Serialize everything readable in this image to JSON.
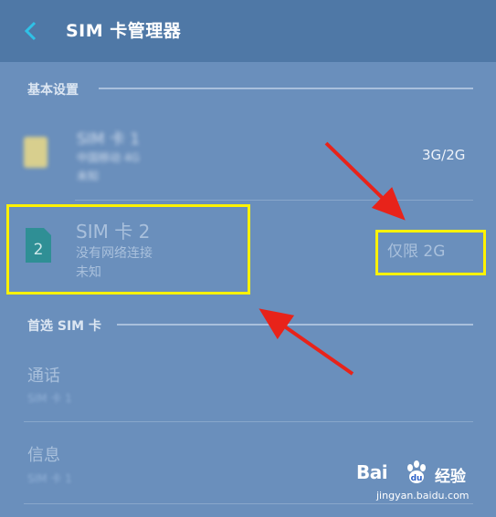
{
  "header": {
    "title": "SIM 卡管理器",
    "back_icon": "chevron-left-icon",
    "accent": "#2fc1e6"
  },
  "sections": {
    "basic": "基本设置",
    "preferred": "首选 SIM 卡"
  },
  "sim1": {
    "name": "SIM 卡 1",
    "carrier": "中国移动 4G",
    "status": "未知",
    "network_type": "3G/2G",
    "icon": "sim-card-icon"
  },
  "sim2": {
    "name": "SIM 卡 2",
    "number": "2",
    "network_status": "没有网络连接",
    "status": "未知",
    "network_type": "仅限 2G",
    "icon": "sim-card-icon"
  },
  "preferred": {
    "call": {
      "label": "通话",
      "value": "SIM 卡 1"
    },
    "message": {
      "label": "信息",
      "value": "SIM 卡 1"
    }
  },
  "watermark": {
    "brand": "Bai",
    "brand2": "经验",
    "url": "jingyan.baidu.com"
  },
  "colors": {
    "highlight": "#fff200",
    "arrow": "#e8231a",
    "header_bg": "#4f78a6",
    "body_bg": "#6a8fbc"
  }
}
